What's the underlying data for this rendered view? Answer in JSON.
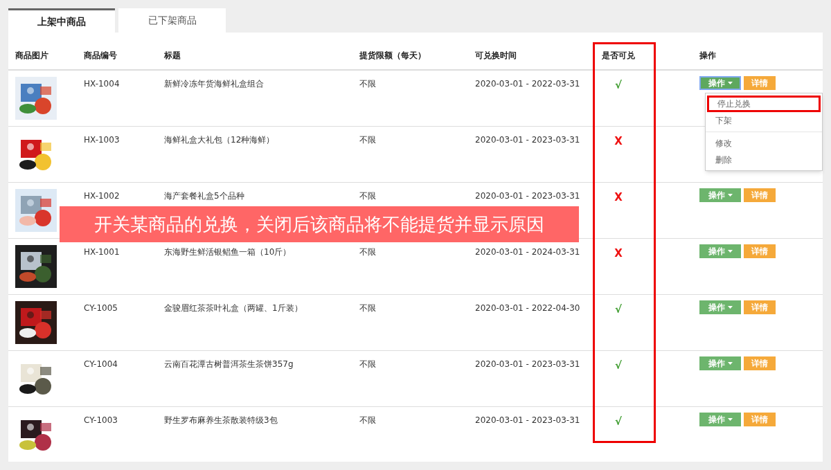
{
  "tabs": [
    {
      "label": "上架中商品",
      "selected": true
    },
    {
      "label": "已下架商品",
      "selected": false
    }
  ],
  "table": {
    "columns": [
      "商品图片",
      "商品编号",
      "标题",
      "提货限额（每天）",
      "可兑换时间",
      "是否可兑",
      "操作"
    ],
    "rows": [
      {
        "code": "HX-1004",
        "title": "新鲜冷冻年货海鲜礼盒组合",
        "limit": "不限",
        "period": "2020-03-01 - 2022-03-31",
        "exchangeable": true,
        "mark": "√",
        "action": "操作",
        "detail": "详情",
        "menu_open": true
      },
      {
        "code": "HX-1003",
        "title": "海鲜礼盒大礼包（12种海鲜）",
        "limit": "不限",
        "period": "2020-03-01 - 2023-03-31",
        "exchangeable": false,
        "mark": "X"
      },
      {
        "code": "HX-1002",
        "title": "海产套餐礼盒5个品种",
        "limit": "不限",
        "period": "2020-03-01 - 2023-03-31",
        "exchangeable": false,
        "mark": "X",
        "action": "操作",
        "detail": "详情",
        "menu_open": false
      },
      {
        "code": "HX-1001",
        "title": "东海野生鲜活银鲳鱼一箱（10斤）",
        "limit": "不限",
        "period": "2020-03-01 - 2024-03-31",
        "exchangeable": false,
        "mark": "X",
        "action": "操作",
        "detail": "详情",
        "menu_open": false
      },
      {
        "code": "CY-1005",
        "title": "金骏眉红茶茶叶礼盒（两罐、1斤装）",
        "limit": "不限",
        "period": "2020-03-01 - 2022-04-30",
        "exchangeable": true,
        "mark": "√",
        "action": "操作",
        "detail": "详情",
        "menu_open": false
      },
      {
        "code": "CY-1004",
        "title": "云南百花潭古树普洱茶生茶饼357g",
        "limit": "不限",
        "period": "2020-03-01 - 2023-03-31",
        "exchangeable": true,
        "mark": "√",
        "action": "操作",
        "detail": "详情",
        "menu_open": false
      },
      {
        "code": "CY-1003",
        "title": "野生罗布麻养生茶散装特级3包",
        "limit": "不限",
        "period": "2020-03-01 - 2023-03-31",
        "exchangeable": true,
        "mark": "√",
        "action": "操作",
        "detail": "详情",
        "menu_open": false
      }
    ]
  },
  "action_menu": {
    "groups": [
      [
        {
          "label": "停止兑换",
          "highlighted": true
        },
        {
          "label": "下架",
          "highlighted": false
        }
      ],
      [
        {
          "label": "修改",
          "highlighted": false
        },
        {
          "label": "删除",
          "highlighted": false
        }
      ]
    ]
  },
  "annotation": {
    "text": "开关某商品的兑换，关闭后该商品将不能提货并显示原因"
  }
}
